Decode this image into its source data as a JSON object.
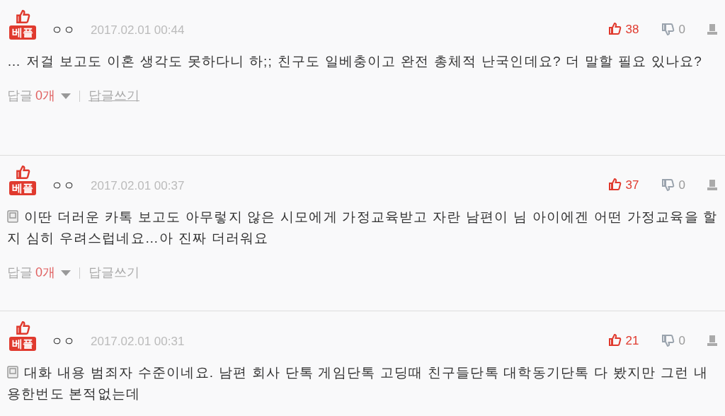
{
  "comments": [
    {
      "badge": "베플",
      "author": "ㅇㅇ",
      "date": "2017.02.01 00:44",
      "likes": "38",
      "dislikes": "0",
      "mobile": false,
      "text": "… 저걸 보고도 이혼 생각도 못하다니 하;; 친구도 일베충이고 완전 총체적 난국인데요? 더 말할 필요 있나요?",
      "replies": {
        "label": "답글",
        "count": "0개",
        "write": "답글쓰기",
        "write_underlined": true
      }
    },
    {
      "badge": "베플",
      "author": "ㅇㅇ",
      "date": "2017.02.01 00:37",
      "likes": "37",
      "dislikes": "0",
      "mobile": true,
      "text": "이딴 더러운 카톡 보고도 아무렇지 않은 시모에게 가정교육받고 자란 남편이 님 아이에겐 어떤 가정교육을 할지 심히 우려스럽네요…아 진짜 더러워요",
      "replies": {
        "label": "답글",
        "count": "0개",
        "write": "답글쓰기",
        "write_underlined": false
      }
    },
    {
      "badge": "베플",
      "author": "ㅇㅇ",
      "date": "2017.02.01 00:31",
      "likes": "21",
      "dislikes": "0",
      "mobile": true,
      "text": "대화 내용 범죄자 수준이네요. 남편 회사 단톡 게임단톡 고딩때 친구들단톡 대학동기단톡 다 봤지만 그런 내용한번도 본적없는데"
    }
  ]
}
